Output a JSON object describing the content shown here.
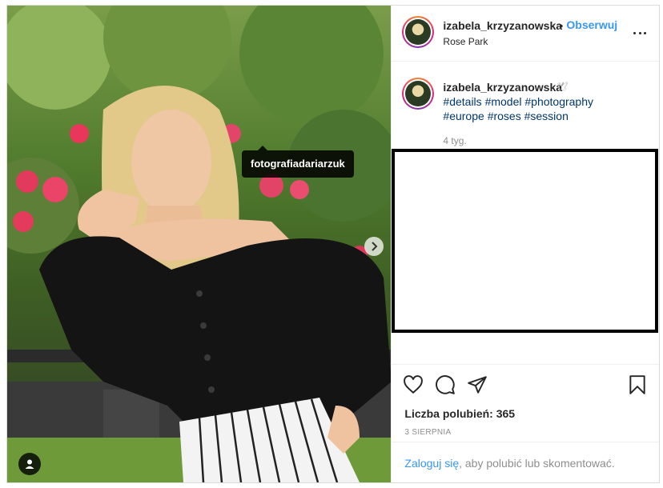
{
  "post": {
    "username": "izabela_krzyzanowska",
    "follow_label": "Obserwuj",
    "separator": "•",
    "location": "Rose Park",
    "photo_tag": "fotografiadariarzuk"
  },
  "caption": {
    "username": "izabela_krzyzanowska",
    "emoji": "🕊",
    "hashtags": [
      "#details",
      "#model",
      "#photography",
      "#europe",
      "#roses",
      "#session"
    ],
    "time_ago": "4 tyg."
  },
  "actions": {
    "likes": "Liczba polubień: 365",
    "date": "3 SIERPNIA"
  },
  "footer": {
    "login_link": "Zaloguj się",
    "login_text": ", aby polubić lub skomentować."
  },
  "colors": {
    "accent": "#3897f0",
    "hashtag": "#00376b",
    "muted": "#8e8e8e"
  },
  "icons": [
    "more-icon",
    "heart-icon",
    "comment-icon",
    "share-icon",
    "bookmark-icon",
    "chevron-right-icon",
    "user-tag-icon"
  ]
}
